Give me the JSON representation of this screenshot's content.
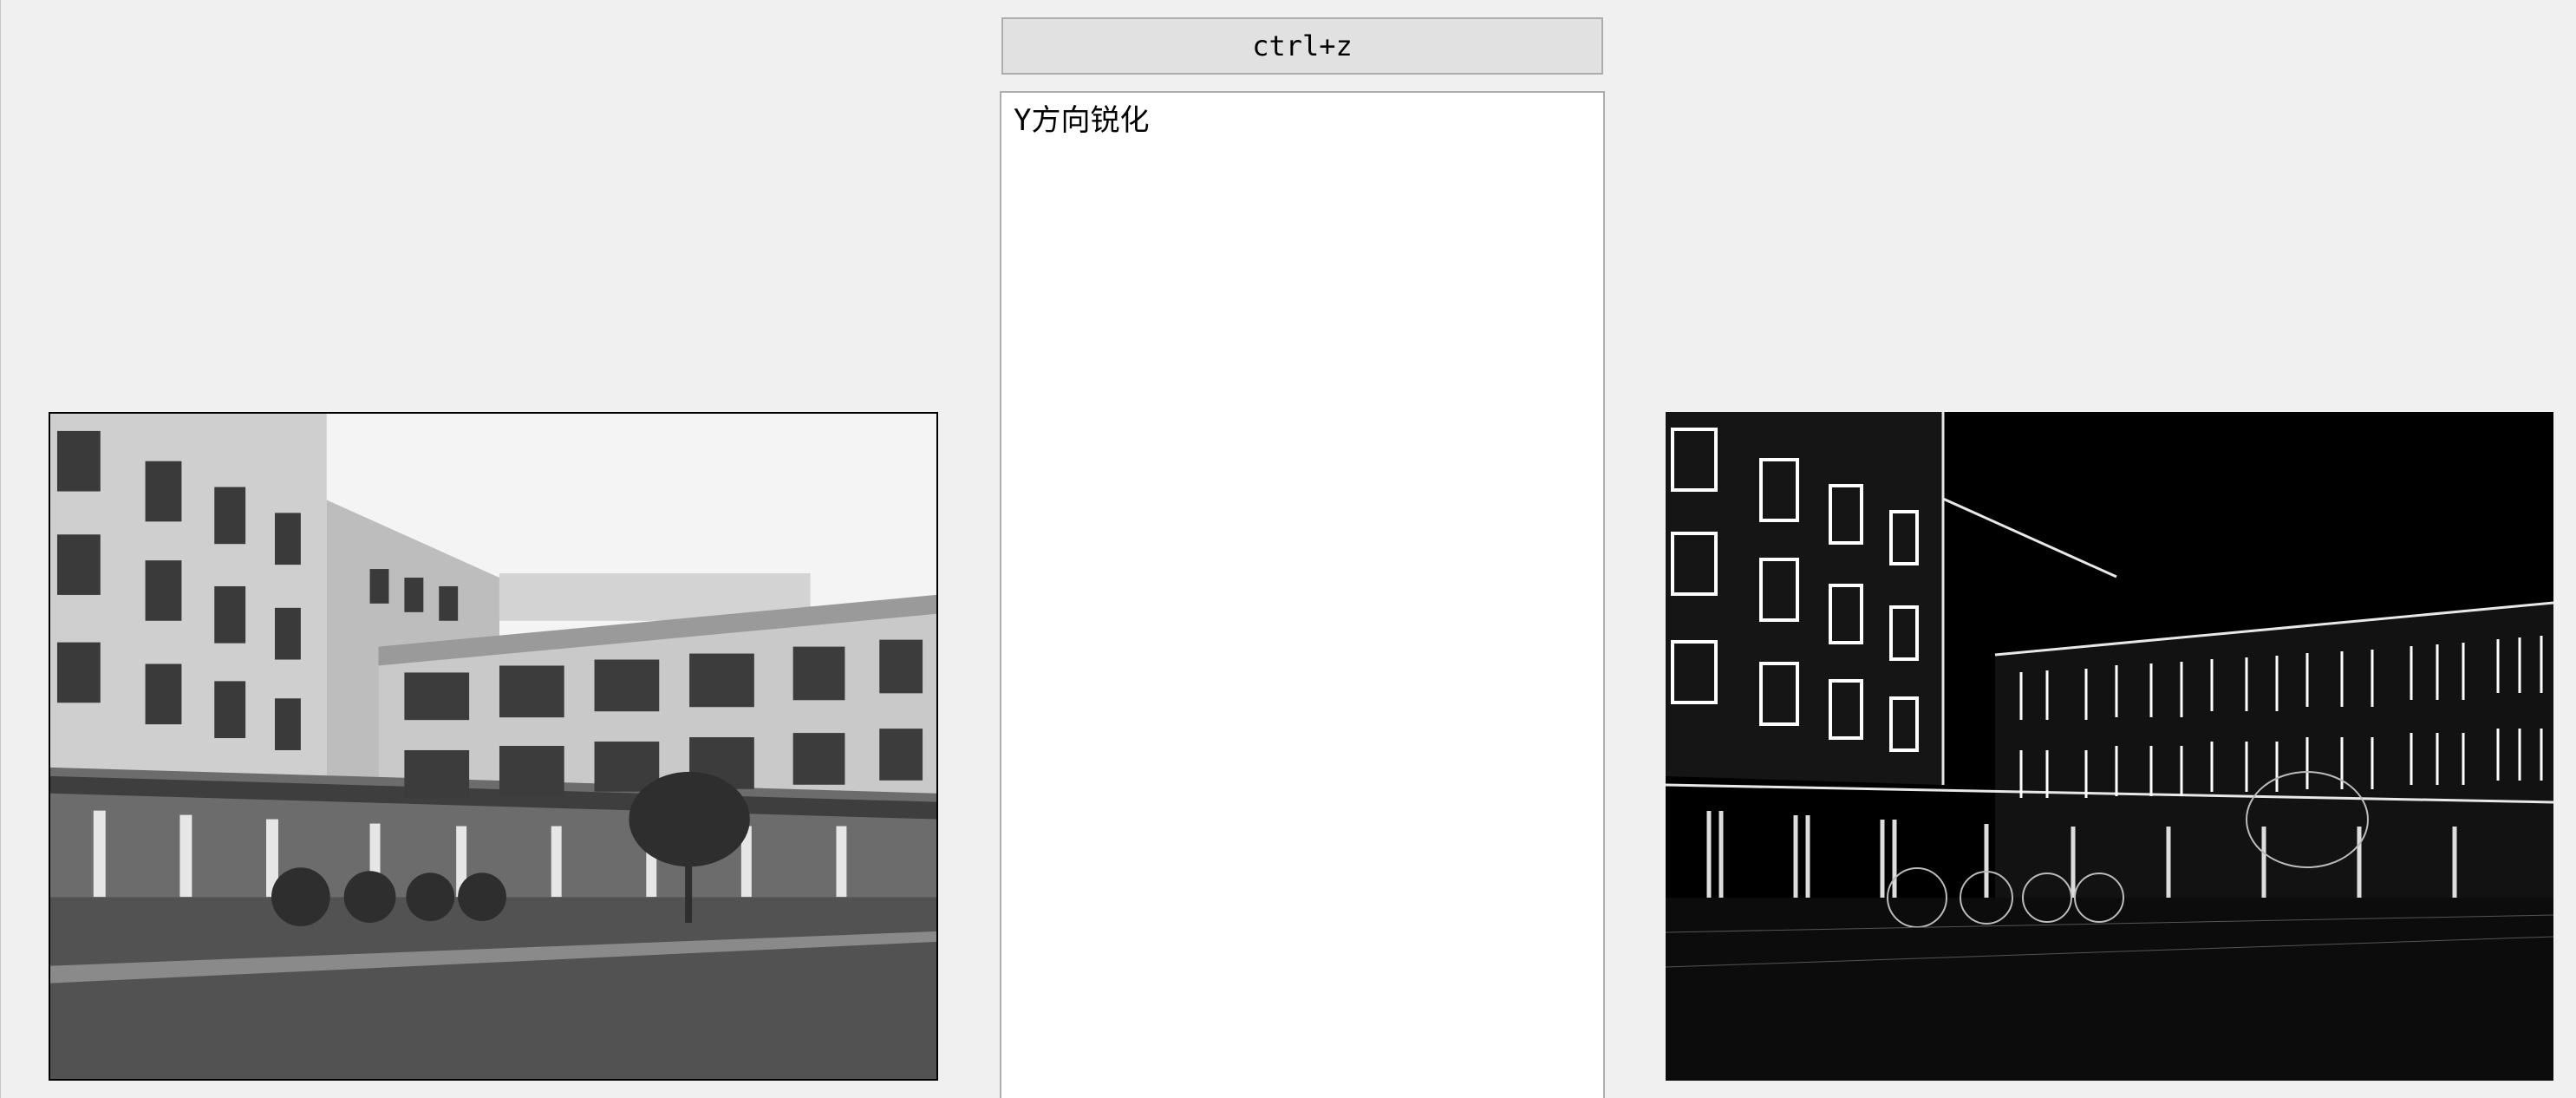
{
  "toolbar": {
    "undo_label": "ctrl+z"
  },
  "log": {
    "lines": [
      "Y方向锐化"
    ]
  },
  "images": {
    "original": {
      "name": "original-image",
      "description_icon": "photo-icon"
    },
    "processed": {
      "name": "processed-image",
      "description_icon": "photo-icon"
    }
  },
  "colors": {
    "window_bg": "#f0f0f0",
    "button_bg": "#e1e1e1",
    "border": "#adadad",
    "text": "#000000"
  }
}
